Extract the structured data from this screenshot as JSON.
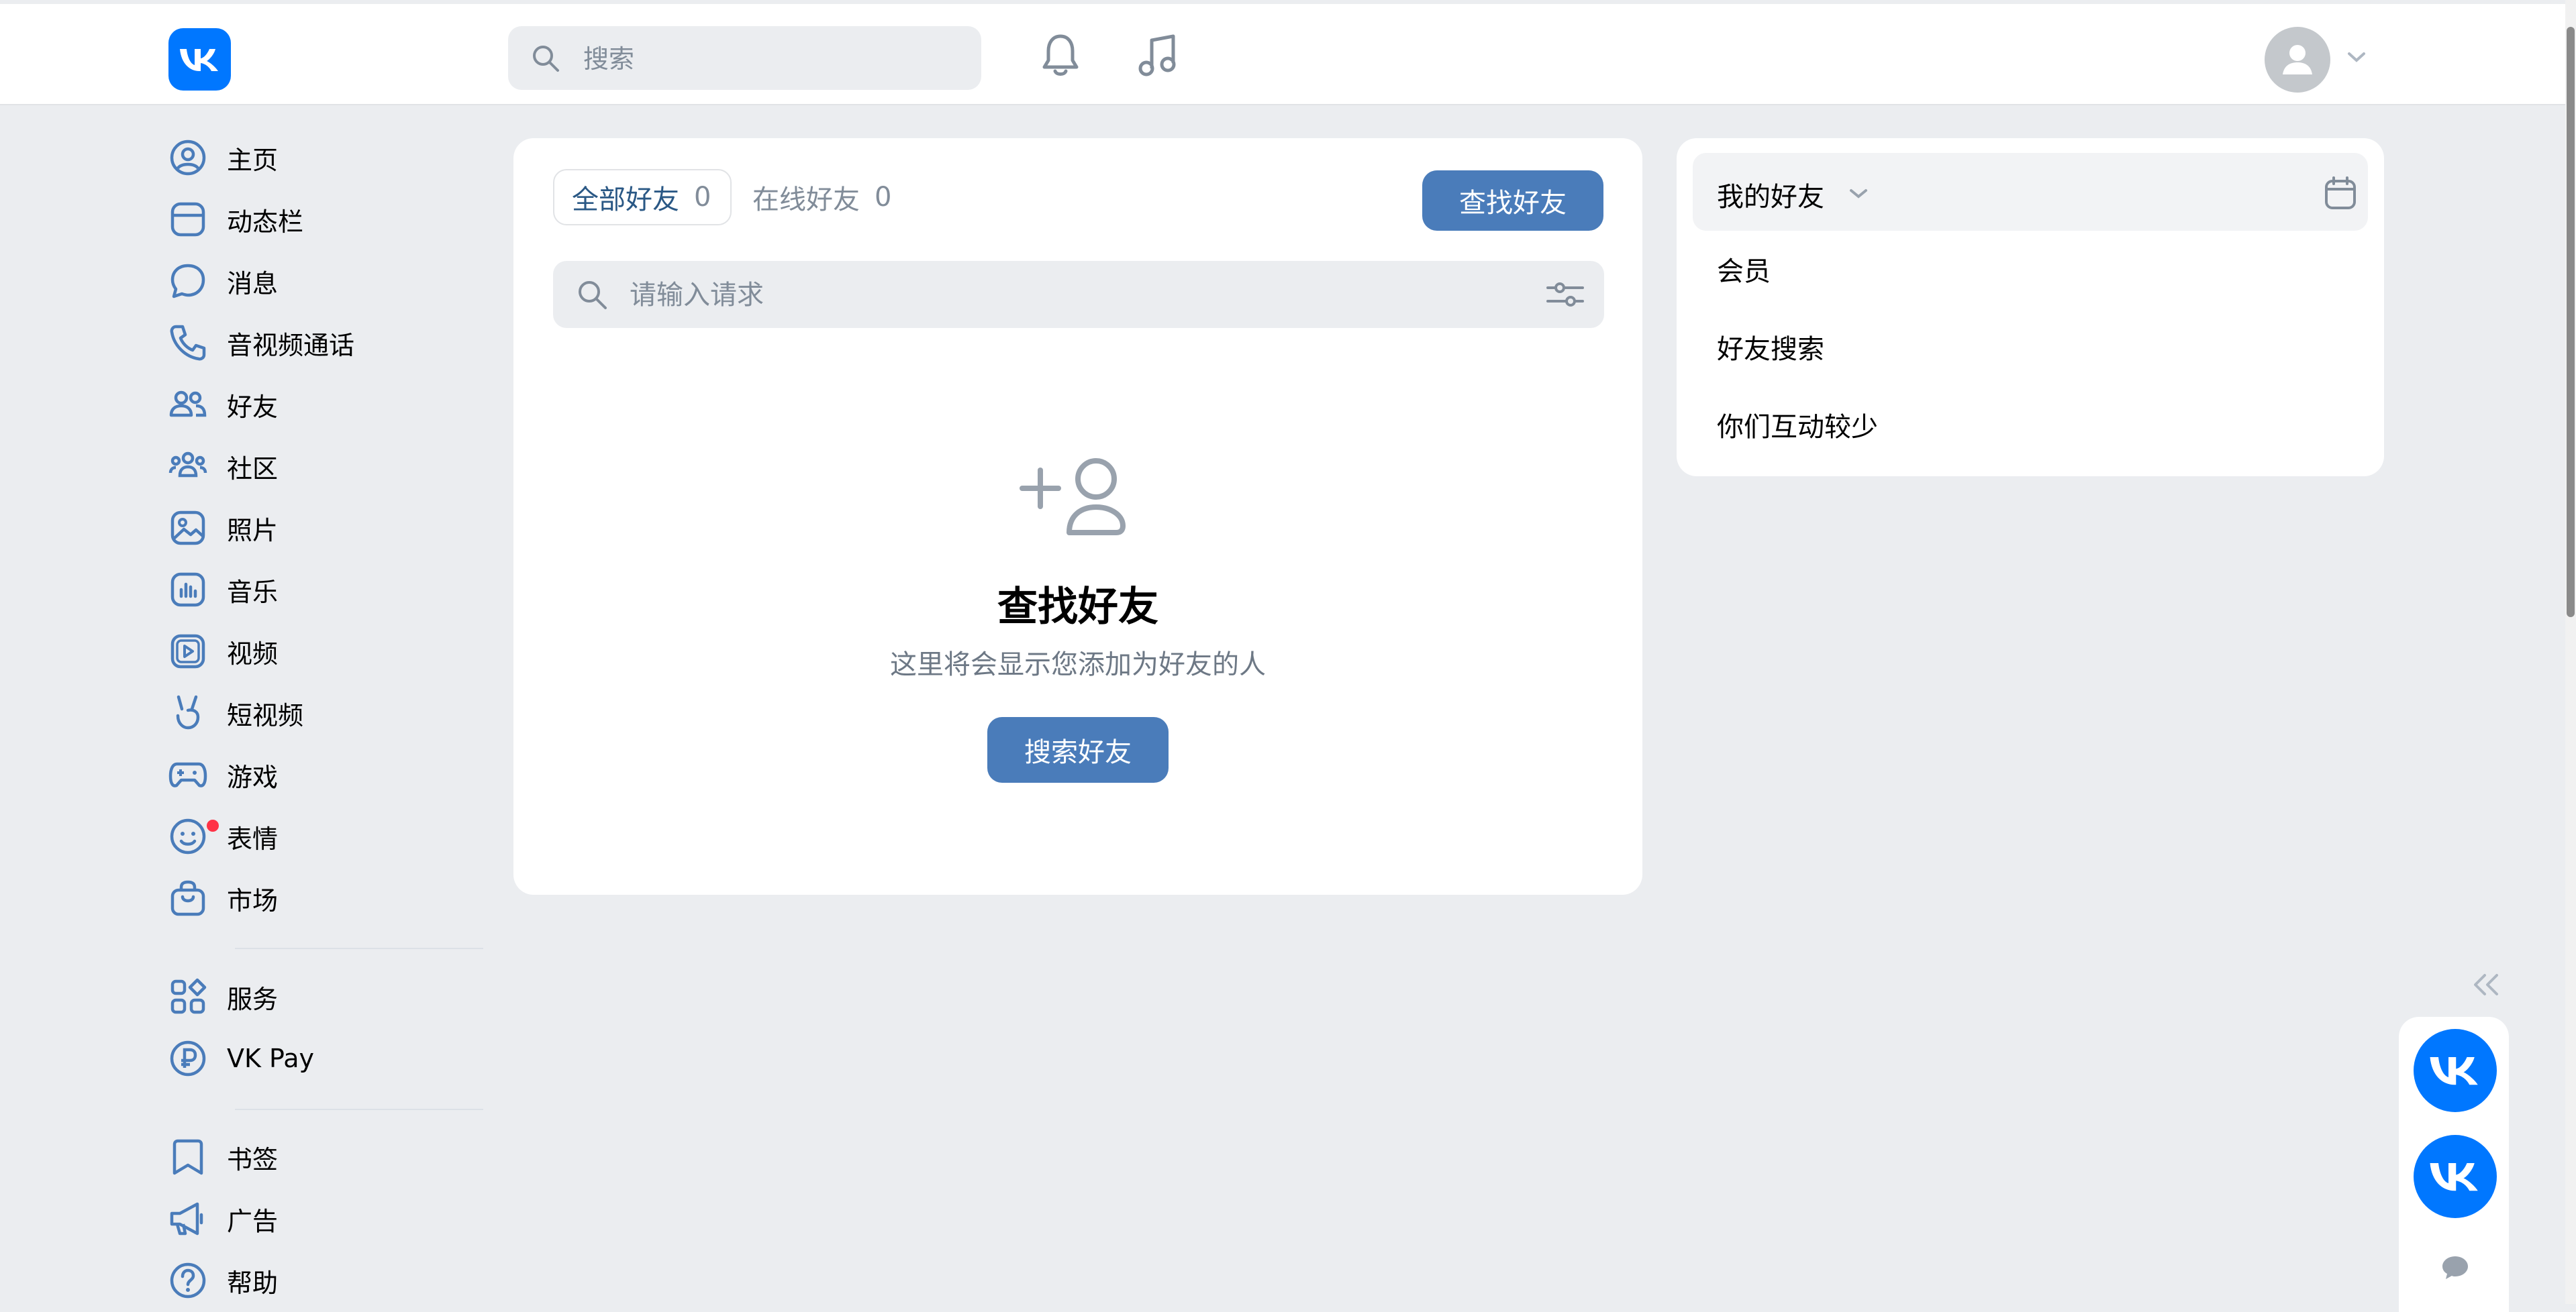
{
  "header": {
    "search_placeholder": "搜索",
    "bell_icon": "bell-icon",
    "music_icon": "music-note-icon"
  },
  "sidebar": {
    "items": [
      {
        "label": "主页",
        "icon": "user-circle-icon"
      },
      {
        "label": "动态栏",
        "icon": "newsfeed-icon"
      },
      {
        "label": "消息",
        "icon": "message-bubble-icon"
      },
      {
        "label": "音视频通话",
        "icon": "phone-icon"
      },
      {
        "label": "好友",
        "icon": "friends-icon"
      },
      {
        "label": "社区",
        "icon": "community-icon"
      },
      {
        "label": "照片",
        "icon": "photo-icon"
      },
      {
        "label": "音乐",
        "icon": "music-icon"
      },
      {
        "label": "视频",
        "icon": "video-icon"
      },
      {
        "label": "短视频",
        "icon": "clips-icon"
      },
      {
        "label": "游戏",
        "icon": "gamepad-icon"
      },
      {
        "label": "表情",
        "icon": "smile-icon"
      },
      {
        "label": "市场",
        "icon": "shopping-bag-icon"
      },
      {
        "label": "服务",
        "icon": "services-icon"
      },
      {
        "label": "VK Pay",
        "icon": "ruble-icon"
      },
      {
        "label": "书签",
        "icon": "bookmark-icon"
      },
      {
        "label": "广告",
        "icon": "megaphone-icon"
      },
      {
        "label": "帮助",
        "icon": "help-icon"
      }
    ]
  },
  "main": {
    "tabs": [
      {
        "label": "全部好友",
        "count": "0"
      },
      {
        "label": "在线好友",
        "count": "0"
      }
    ],
    "find_button": "查找好友",
    "search_placeholder": "请输入请求",
    "empty_title": "查找好友",
    "empty_subtitle": "这里将会显示您添加为好友的人",
    "search_friends_button": "搜索好友"
  },
  "right_panel": {
    "header_label": "我的好友",
    "items": [
      "会员",
      "好友搜索",
      "你们互动较少"
    ]
  },
  "colors": {
    "accent": "#4a7cba",
    "brand": "#0077ff",
    "background": "#ebedf0",
    "link": "#2a5885",
    "notification": "#ff3347"
  }
}
